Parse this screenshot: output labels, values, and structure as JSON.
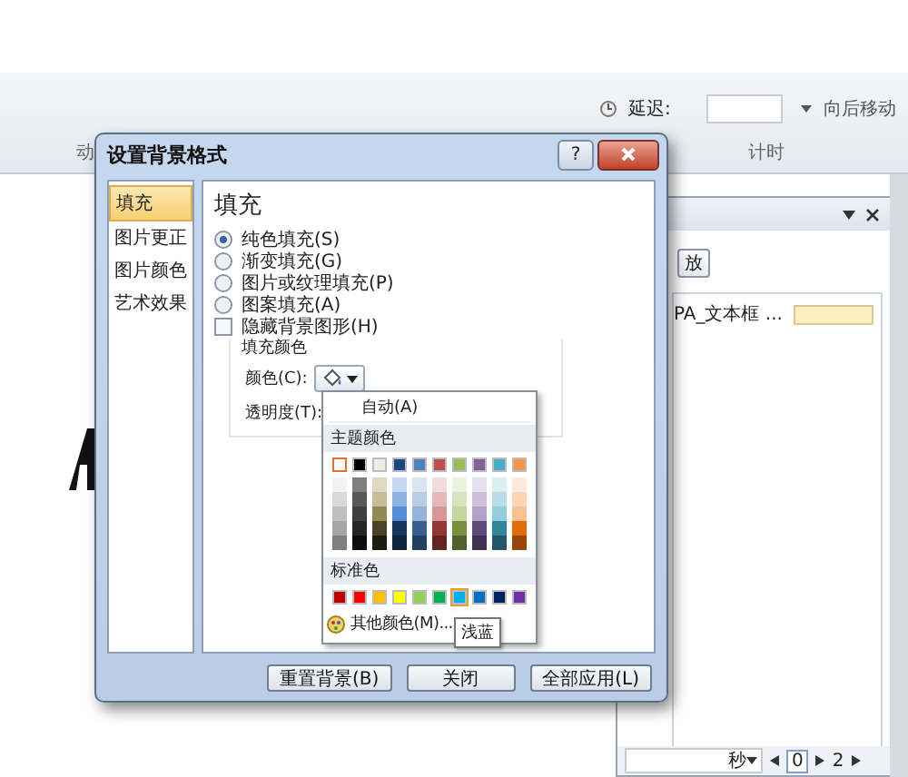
{
  "ribbon": {
    "delay_label": "延迟:",
    "move_button": "向后移动",
    "groups": [
      "动",
      "计时"
    ]
  },
  "dialog": {
    "title": "设置背景格式",
    "help": "?",
    "nav": [
      {
        "label": "填充",
        "selected": true
      },
      {
        "label": "图片更正",
        "selected": false
      },
      {
        "label": "图片颜色",
        "selected": false
      },
      {
        "label": "艺术效果",
        "selected": false
      }
    ],
    "heading": "填充",
    "fill_options": [
      {
        "label": "纯色填充(S)",
        "selected": true
      },
      {
        "label": "渐变填充(G)",
        "selected": false
      },
      {
        "label": "图片或纹理填充(P)",
        "selected": false
      },
      {
        "label": "图案填充(A)",
        "selected": false
      }
    ],
    "hide_background": {
      "label": "隐藏背景图形(H)",
      "checked": false
    },
    "fill_color": {
      "title": "填充颜色",
      "color_label": "颜色(C):",
      "transparency_label": "透明度(T):"
    },
    "color_menu": {
      "auto": "自动(A)",
      "theme_title": "主题颜色",
      "theme_colors": [
        {
          "color": "#ffffff",
          "selected": true,
          "shades": [
            {
              "color": "#f2f2f2"
            },
            {
              "color": "#d9d9d9"
            },
            {
              "color": "#bfbfbf"
            },
            {
              "color": "#a6a6a6"
            },
            {
              "color": "#808080"
            }
          ]
        },
        {
          "color": "#000000",
          "selected": false,
          "shades": [
            {
              "color": "#7f7f7f"
            },
            {
              "color": "#595959"
            },
            {
              "color": "#3f3f3f"
            },
            {
              "color": "#262626"
            },
            {
              "color": "#0d0d0d"
            }
          ]
        },
        {
          "color": "#eeece1",
          "selected": false,
          "shades": [
            {
              "color": "#ddd9c3"
            },
            {
              "color": "#c4bd97"
            },
            {
              "color": "#938953"
            },
            {
              "color": "#494429"
            },
            {
              "color": "#1d1b10"
            }
          ]
        },
        {
          "color": "#1f497d",
          "selected": false,
          "shades": [
            {
              "color": "#c6d9f1"
            },
            {
              "color": "#8db3e2"
            },
            {
              "color": "#548dd4"
            },
            {
              "color": "#17365d"
            },
            {
              "color": "#0f243e"
            }
          ]
        },
        {
          "color": "#4f81bd",
          "selected": false,
          "shades": [
            {
              "color": "#dbe5f1"
            },
            {
              "color": "#b8cce4"
            },
            {
              "color": "#95b3d7"
            },
            {
              "color": "#366092"
            },
            {
              "color": "#244061"
            }
          ]
        },
        {
          "color": "#c0504d",
          "selected": false,
          "shades": [
            {
              "color": "#f2dcdb"
            },
            {
              "color": "#e5b9b7"
            },
            {
              "color": "#d99694"
            },
            {
              "color": "#953734"
            },
            {
              "color": "#632423"
            }
          ]
        },
        {
          "color": "#9bbb59",
          "selected": false,
          "shades": [
            {
              "color": "#ebf1dd"
            },
            {
              "color": "#d7e3bc"
            },
            {
              "color": "#c3d69b"
            },
            {
              "color": "#76923c"
            },
            {
              "color": "#4f6128"
            }
          ]
        },
        {
          "color": "#8064a2",
          "selected": false,
          "shades": [
            {
              "color": "#e5e0ec"
            },
            {
              "color": "#ccc1d9"
            },
            {
              "color": "#b2a2c7"
            },
            {
              "color": "#5f497a"
            },
            {
              "color": "#3f3151"
            }
          ]
        },
        {
          "color": "#4bacc6",
          "selected": false,
          "shades": [
            {
              "color": "#dbeef3"
            },
            {
              "color": "#b7dde8"
            },
            {
              "color": "#92cddc"
            },
            {
              "color": "#31859b"
            },
            {
              "color": "#205867"
            }
          ]
        },
        {
          "color": "#f79646",
          "selected": false,
          "shades": [
            {
              "color": "#fdeada"
            },
            {
              "color": "#fbd5b5"
            },
            {
              "color": "#fac08f"
            },
            {
              "color": "#e36c09"
            },
            {
              "color": "#974806"
            }
          ]
        }
      ],
      "standard_title": "标准色",
      "standard_colors": [
        {
          "color": "#c00000",
          "hovered": false
        },
        {
          "color": "#ff0000",
          "hovered": false
        },
        {
          "color": "#ffc000",
          "hovered": false
        },
        {
          "color": "#ffff00",
          "hovered": false
        },
        {
          "color": "#92d050",
          "hovered": false
        },
        {
          "color": "#00b050",
          "hovered": false
        },
        {
          "color": "#00b0f0",
          "hovered": true
        },
        {
          "color": "#0070c0",
          "hovered": false
        },
        {
          "color": "#002060",
          "hovered": false
        },
        {
          "color": "#7030a0",
          "hovered": false
        }
      ],
      "more": "其他颜色(M)...",
      "tooltip": "浅蓝"
    },
    "buttons": [
      "重置背景(B)",
      "关闭",
      "全部应用(L)"
    ]
  },
  "task_pane": {
    "button": "放",
    "items": [
      {
        "label": "PA_文本框 ..."
      }
    ],
    "unit": "秒",
    "page_current": "0",
    "page_next": "2"
  }
}
